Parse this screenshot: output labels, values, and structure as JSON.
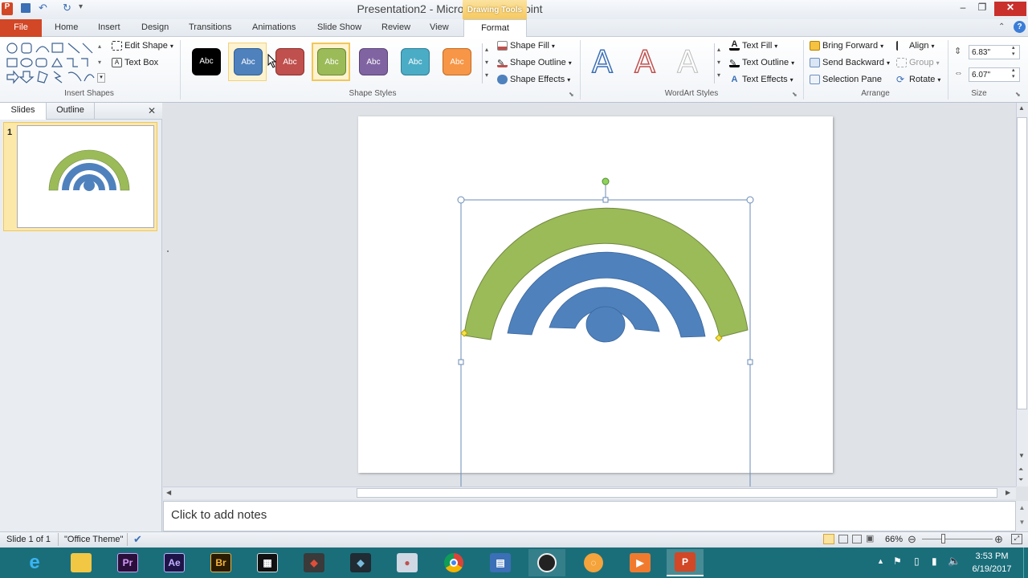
{
  "window": {
    "title": "Presentation2  -  Microsoft PowerPoint",
    "context_tab": "Drawing Tools"
  },
  "tabs": [
    "File",
    "Home",
    "Insert",
    "Design",
    "Transitions",
    "Animations",
    "Slide Show",
    "Review",
    "View",
    "Format"
  ],
  "ribbon": {
    "insert_shapes": {
      "edit_shape": "Edit Shape",
      "text_box": "Text Box",
      "label": "Insert Shapes"
    },
    "shape_styles": {
      "label": "Shape Styles",
      "swatches": [
        {
          "text": "Abc",
          "color": "#000000"
        },
        {
          "text": "Abc",
          "color": "#4f81bd"
        },
        {
          "text": "Abc",
          "color": "#c0504d"
        },
        {
          "text": "Abc",
          "color": "#9bbb59"
        },
        {
          "text": "Abc",
          "color": "#8064a2"
        },
        {
          "text": "Abc",
          "color": "#4bacc6"
        },
        {
          "text": "Abc",
          "color": "#f79646"
        }
      ],
      "shape_fill": "Shape Fill",
      "shape_outline": "Shape Outline",
      "shape_effects": "Shape Effects"
    },
    "wordart_styles": {
      "label": "WordArt Styles",
      "text_fill": "Text Fill",
      "text_outline": "Text Outline",
      "text_effects": "Text Effects"
    },
    "arrange": {
      "label": "Arrange",
      "bring_forward": "Bring Forward",
      "send_backward": "Send Backward",
      "selection_pane": "Selection Pane",
      "align": "Align",
      "group": "Group",
      "rotate": "Rotate"
    },
    "size": {
      "label": "Size",
      "height": "6.83\"",
      "width": "6.07\""
    }
  },
  "panes": {
    "slides_tab": "Slides",
    "outline_tab": "Outline",
    "slide_number": "1"
  },
  "notes": {
    "placeholder": "Click to add notes"
  },
  "status": {
    "slide": "Slide 1 of 1",
    "theme": "\"Office Theme\"",
    "zoom": "66%"
  },
  "clock": {
    "time": "3:53 PM",
    "date": "6/19/2017"
  },
  "colors": {
    "green_arc": "#9bbb59",
    "blue_arc": "#4f81bd",
    "file_tab": "#d24726"
  }
}
